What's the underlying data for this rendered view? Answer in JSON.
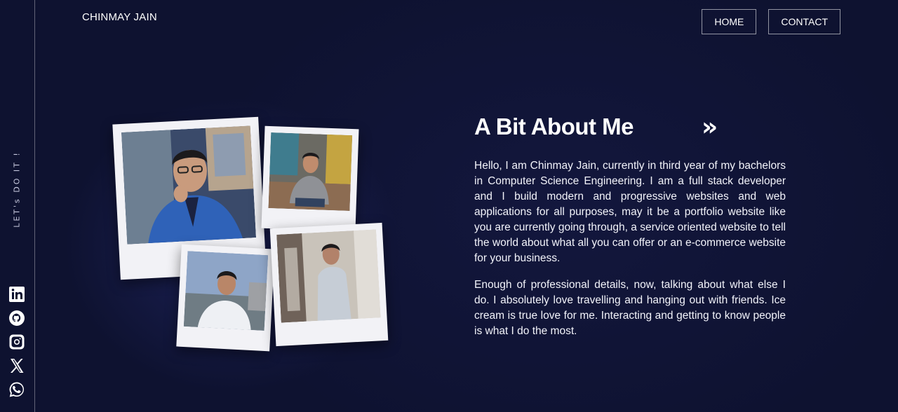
{
  "header": {
    "brand": "CHINMAY JAIN",
    "nav": [
      {
        "label": "HOME"
      },
      {
        "label": "CONTACT"
      }
    ]
  },
  "rail": {
    "tagline": "LET's DO IT !",
    "social": [
      {
        "icon": "linkedin-icon"
      },
      {
        "icon": "github-icon"
      },
      {
        "icon": "instagram-icon"
      },
      {
        "icon": "x-twitter-icon"
      },
      {
        "icon": "whatsapp-icon"
      }
    ]
  },
  "about": {
    "title": "A Bit About Me",
    "next_icon": "»",
    "paragraphs": [
      "Hello, I am Chinmay Jain, currently in third year of my bachelors in Computer Science Engineering. I am a full stack developer and I build modern and progressive websites and web applications for all purposes, may it be a portfolio website like you are currently going through, a service oriented website to tell the world about what all you can offer or an e-commerce website for your business.",
      "Enough of professional details, now, talking about what else I do. I absolutely love travelling and hanging out with friends. Ice cream is true love for me. Interacting and getting to know people is what I do the most."
    ]
  },
  "colors": {
    "background": "#0e1230",
    "text": "#ffffff",
    "polaroid": "#f2f2f6"
  }
}
